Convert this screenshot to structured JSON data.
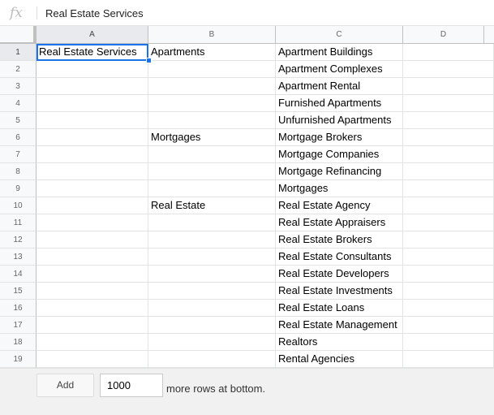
{
  "formula_bar": {
    "fx_label": "fx",
    "value": "Real Estate Services"
  },
  "columns": [
    "A",
    "B",
    "C",
    "D"
  ],
  "rows": [
    {
      "num": "1",
      "a": "Real Estate Services",
      "b": "Apartments",
      "c": "Apartment Buildings",
      "d": ""
    },
    {
      "num": "2",
      "a": "",
      "b": "",
      "c": "Apartment Complexes",
      "d": ""
    },
    {
      "num": "3",
      "a": "",
      "b": "",
      "c": "Apartment Rental",
      "d": ""
    },
    {
      "num": "4",
      "a": "",
      "b": "",
      "c": "Furnished Apartments",
      "d": ""
    },
    {
      "num": "5",
      "a": "",
      "b": "",
      "c": "Unfurnished Apartments",
      "d": ""
    },
    {
      "num": "6",
      "a": "",
      "b": "Mortgages",
      "c": "Mortgage Brokers",
      "d": ""
    },
    {
      "num": "7",
      "a": "",
      "b": "",
      "c": "Mortgage Companies",
      "d": ""
    },
    {
      "num": "8",
      "a": "",
      "b": "",
      "c": "Mortgage Refinancing",
      "d": ""
    },
    {
      "num": "9",
      "a": "",
      "b": "",
      "c": "Mortgages",
      "d": ""
    },
    {
      "num": "10",
      "a": "",
      "b": "Real Estate",
      "c": "Real Estate Agency",
      "d": ""
    },
    {
      "num": "11",
      "a": "",
      "b": "",
      "c": "Real Estate Appraisers",
      "d": ""
    },
    {
      "num": "12",
      "a": "",
      "b": "",
      "c": "Real Estate Brokers",
      "d": ""
    },
    {
      "num": "13",
      "a": "",
      "b": "",
      "c": "Real Estate Consultants",
      "d": ""
    },
    {
      "num": "14",
      "a": "",
      "b": "",
      "c": "Real Estate Developers",
      "d": ""
    },
    {
      "num": "15",
      "a": "",
      "b": "",
      "c": "Real Estate Investments",
      "d": ""
    },
    {
      "num": "16",
      "a": "",
      "b": "",
      "c": "Real Estate Loans",
      "d": ""
    },
    {
      "num": "17",
      "a": "",
      "b": "",
      "c": "Real Estate Management",
      "d": ""
    },
    {
      "num": "18",
      "a": "",
      "b": "",
      "c": "Realtors",
      "d": ""
    },
    {
      "num": "19",
      "a": "",
      "b": "",
      "c": "Rental Agencies",
      "d": ""
    }
  ],
  "footer": {
    "add_label": "Add",
    "rows_value": "1000",
    "more_rows_label": "more rows at bottom."
  },
  "colors": {
    "selection": "#1a73e8",
    "header_bg": "#f8f9fa",
    "gridline": "#e2e3e3"
  }
}
